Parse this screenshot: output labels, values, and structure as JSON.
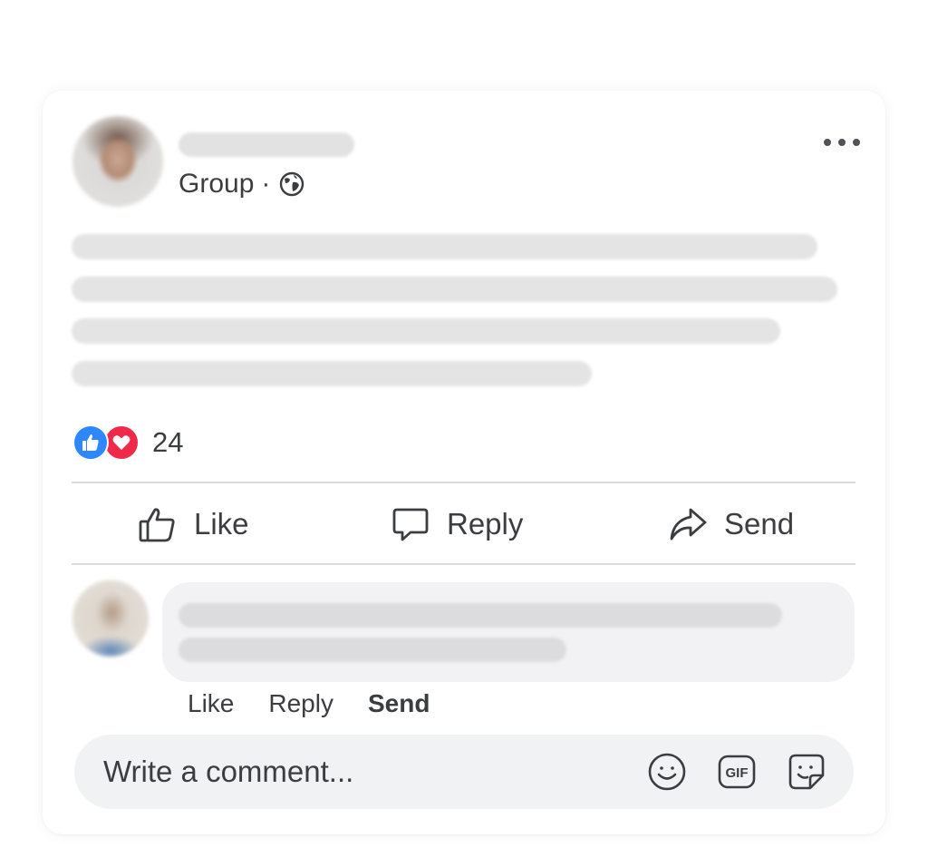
{
  "post": {
    "audience": "Group",
    "separator": "·",
    "audience_icon": "globe-icon",
    "menu_icon": "more-horizontal-icon"
  },
  "reactions": {
    "icons": [
      "like-reaction-icon",
      "love-reaction-icon"
    ],
    "count": "24",
    "colors": {
      "like": "#2d88ff",
      "love": "#f0284a"
    }
  },
  "actions": {
    "like": "Like",
    "reply": "Reply",
    "send": "Send"
  },
  "comment": {
    "actions": {
      "like": "Like",
      "reply": "Reply",
      "send": "Send"
    }
  },
  "composer": {
    "placeholder": "Write a comment...",
    "icons": [
      "emoji-icon",
      "gif-icon",
      "sticker-icon"
    ]
  }
}
